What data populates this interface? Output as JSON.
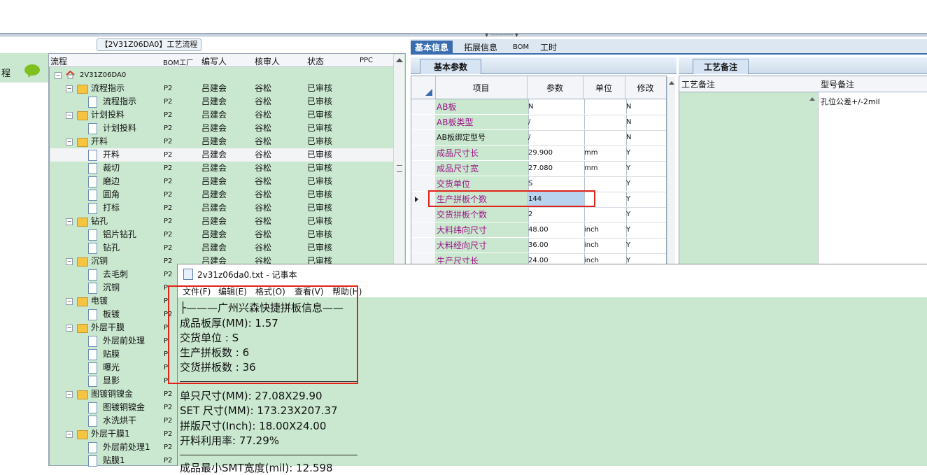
{
  "left_panel": {
    "label": "程"
  },
  "tree": {
    "title": "【2V31Z06DA0】工艺流程",
    "headers": [
      "流程",
      "BOM工厂",
      "编写人",
      "核审人",
      "状态",
      "PPC"
    ],
    "root": "2V31Z06DA0",
    "rows": [
      {
        "name": "流程指示",
        "type": "folder",
        "plant": "P2",
        "writer": "吕建会",
        "reviewer": "谷松",
        "status": "已审核"
      },
      {
        "name": "流程指示",
        "type": "doc",
        "plant": "P2",
        "writer": "吕建会",
        "reviewer": "谷松",
        "status": "已审核"
      },
      {
        "name": "计划投料",
        "type": "folder",
        "plant": "P2",
        "writer": "吕建会",
        "reviewer": "谷松",
        "status": "已审核"
      },
      {
        "name": "计划投料",
        "type": "doc",
        "plant": "P2",
        "writer": "吕建会",
        "reviewer": "谷松",
        "status": "已审核"
      },
      {
        "name": "开料",
        "type": "folder",
        "plant": "P2",
        "writer": "吕建会",
        "reviewer": "谷松",
        "status": "已审核"
      },
      {
        "name": "开料",
        "type": "doc",
        "plant": "P2",
        "writer": "吕建会",
        "reviewer": "谷松",
        "status": "已审核",
        "selected": true
      },
      {
        "name": "裁切",
        "type": "doc",
        "plant": "P2",
        "writer": "吕建会",
        "reviewer": "谷松",
        "status": "已审核"
      },
      {
        "name": "磨边",
        "type": "doc",
        "plant": "P2",
        "writer": "吕建会",
        "reviewer": "谷松",
        "status": "已审核"
      },
      {
        "name": "圆角",
        "type": "doc",
        "plant": "P2",
        "writer": "吕建会",
        "reviewer": "谷松",
        "status": "已审核"
      },
      {
        "name": "打标",
        "type": "doc",
        "plant": "P2",
        "writer": "吕建会",
        "reviewer": "谷松",
        "status": "已审核"
      },
      {
        "name": "钻孔",
        "type": "folder",
        "plant": "P2",
        "writer": "吕建会",
        "reviewer": "谷松",
        "status": "已审核"
      },
      {
        "name": "铝片钻孔",
        "type": "doc",
        "plant": "P2",
        "writer": "吕建会",
        "reviewer": "谷松",
        "status": "已审核"
      },
      {
        "name": "钻孔",
        "type": "doc",
        "plant": "P2",
        "writer": "吕建会",
        "reviewer": "谷松",
        "status": "已审核"
      },
      {
        "name": "沉铜",
        "type": "folder",
        "plant": "P2",
        "writer": "吕建会",
        "reviewer": "谷松",
        "status": "已审核"
      },
      {
        "name": "去毛刺",
        "type": "doc",
        "plant": "P2",
        "writer": "",
        "reviewer": "",
        "status": ""
      },
      {
        "name": "沉铜",
        "type": "doc",
        "plant": "P",
        "writer": "",
        "reviewer": "",
        "status": ""
      },
      {
        "name": "电镀",
        "type": "folder",
        "plant": "P",
        "writer": "",
        "reviewer": "",
        "status": ""
      },
      {
        "name": "板镀",
        "type": "doc",
        "plant": "P2",
        "writer": "",
        "reviewer": "",
        "status": ""
      },
      {
        "name": "外层干膜",
        "type": "folder",
        "plant": "P",
        "writer": "",
        "reviewer": "",
        "status": ""
      },
      {
        "name": "外层前处理",
        "type": "doc",
        "plant": "P",
        "writer": "",
        "reviewer": "",
        "status": ""
      },
      {
        "name": "贴膜",
        "type": "doc",
        "plant": "P",
        "writer": "",
        "reviewer": "",
        "status": ""
      },
      {
        "name": "曝光",
        "type": "doc",
        "plant": "P",
        "writer": "",
        "reviewer": "",
        "status": ""
      },
      {
        "name": "显影",
        "type": "doc",
        "plant": "P",
        "writer": "",
        "reviewer": "",
        "status": ""
      },
      {
        "name": "图镀铜镍金",
        "type": "folder",
        "plant": "P2",
        "writer": "",
        "reviewer": "",
        "status": ""
      },
      {
        "name": "图镀铜镍金",
        "type": "doc",
        "plant": "P2",
        "writer": "",
        "reviewer": "",
        "status": ""
      },
      {
        "name": "水洗烘干",
        "type": "doc",
        "plant": "P2",
        "writer": "",
        "reviewer": "",
        "status": ""
      },
      {
        "name": "外层干膜1",
        "type": "folder",
        "plant": "P2",
        "writer": "",
        "reviewer": "",
        "status": ""
      },
      {
        "name": "外层前处理1",
        "type": "doc",
        "plant": "P2",
        "writer": "",
        "reviewer": "",
        "status": ""
      },
      {
        "name": "贴膜1",
        "type": "doc",
        "plant": "P2",
        "writer": "",
        "reviewer": "",
        "status": ""
      }
    ]
  },
  "tabs": [
    "基本信息",
    "拓展信息",
    "BOM",
    "工时"
  ],
  "param_panel": {
    "subtab": "基本参数",
    "headers": [
      "项目",
      "参数",
      "单位",
      "修改"
    ],
    "rows": [
      {
        "item": "AB板",
        "value": "N",
        "unit": "",
        "mod": "N"
      },
      {
        "item": "AB板类型",
        "value": "/",
        "unit": "",
        "mod": "N"
      },
      {
        "item": "AB板绑定型号",
        "value": "/",
        "unit": "",
        "mod": "N",
        "plain": true
      },
      {
        "item": "成品尺寸长",
        "value": "29.900",
        "unit": "mm",
        "mod": "Y"
      },
      {
        "item": "成品尺寸宽",
        "value": "27.080",
        "unit": "mm",
        "mod": "Y"
      },
      {
        "item": "交货单位",
        "value": "S",
        "unit": "",
        "mod": "Y"
      },
      {
        "item": "生产拼板个数",
        "value": "144",
        "unit": "",
        "mod": "Y",
        "active": true
      },
      {
        "item": "交货拼板个数",
        "value": "2",
        "unit": "",
        "mod": "Y"
      },
      {
        "item": "大料纬向尺寸",
        "value": "48.00",
        "unit": "inch",
        "mod": "Y"
      },
      {
        "item": "大料经向尺寸",
        "value": "36.00",
        "unit": "inch",
        "mod": "Y"
      },
      {
        "item": "生产尺寸长",
        "value": "24.00",
        "unit": "inch",
        "mod": "Y"
      }
    ]
  },
  "notes_panel": {
    "subtab": "工艺备注",
    "headers": [
      "工艺备注",
      "型号备注"
    ],
    "model_note": "孔位公差+/-2mil"
  },
  "notepad": {
    "title": "2v31z06da0.txt - 记事本",
    "menu": [
      "文件(F)",
      "编辑(E)",
      "格式(O)",
      "查看(V)",
      "帮助(H)"
    ],
    "lines": [
      "├———广州兴森快捷拼板信息——",
      "成品板厚(MM): 1.57",
      "交货单位 : S",
      "生产拼板数 : 6",
      "交货拼板数 : 36",
      "单只尺寸(MM): 27.08X29.90",
      "SET 尺寸(MM): 173.23X207.37",
      "拼版尺寸(Inch): 18.00X24.00",
      "开料利用率: 77.29%",
      "成品最小SMT宽度(mil): 12.598"
    ]
  },
  "colors": {
    "accent": "#3a6db0",
    "grid_green": "#c9e8cf",
    "highlight": "#e2231a",
    "magenta_text": "#a0128a"
  }
}
